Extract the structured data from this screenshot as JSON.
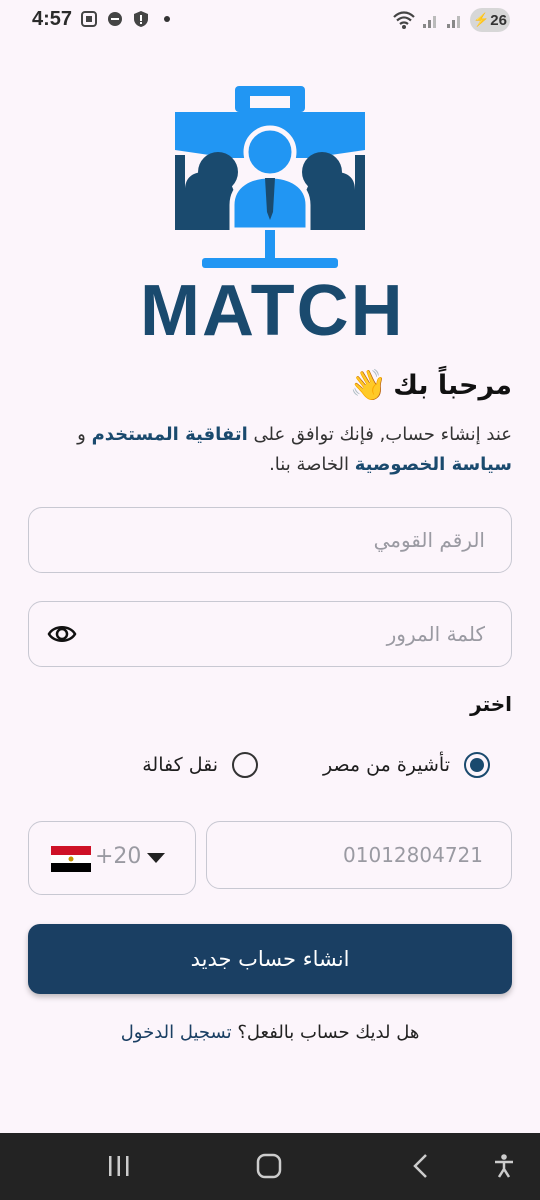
{
  "status_bar": {
    "time": "4:57",
    "battery": "26"
  },
  "brand": {
    "name": "MATCH",
    "colors": {
      "primary": "#1a4a6e",
      "accent": "#2196f3"
    }
  },
  "welcome": {
    "title": "مرحباً بك",
    "emoji": "👋"
  },
  "terms": {
    "prefix": "عند إنشاء حساب, فإنك توافق على",
    "user_agreement": "اتفاقية المستخدم",
    "and": "و",
    "privacy": "سياسة الخصوصية",
    "suffix": "الخاصة بنا."
  },
  "form": {
    "national_id_placeholder": "الرقم القومي",
    "password_placeholder": "كلمة المرور",
    "choose_label": "اختر",
    "options": [
      {
        "label": "تأشيرة من مصر",
        "selected": true
      },
      {
        "label": "نقل كفالة",
        "selected": false
      }
    ],
    "country_code": "+20",
    "phone_placeholder": "01012804721",
    "submit_label": "انشاء حساب جديد"
  },
  "footer": {
    "question": "هل لديك حساب بالفعل؟",
    "login_link": "تسجيل الدخول"
  }
}
